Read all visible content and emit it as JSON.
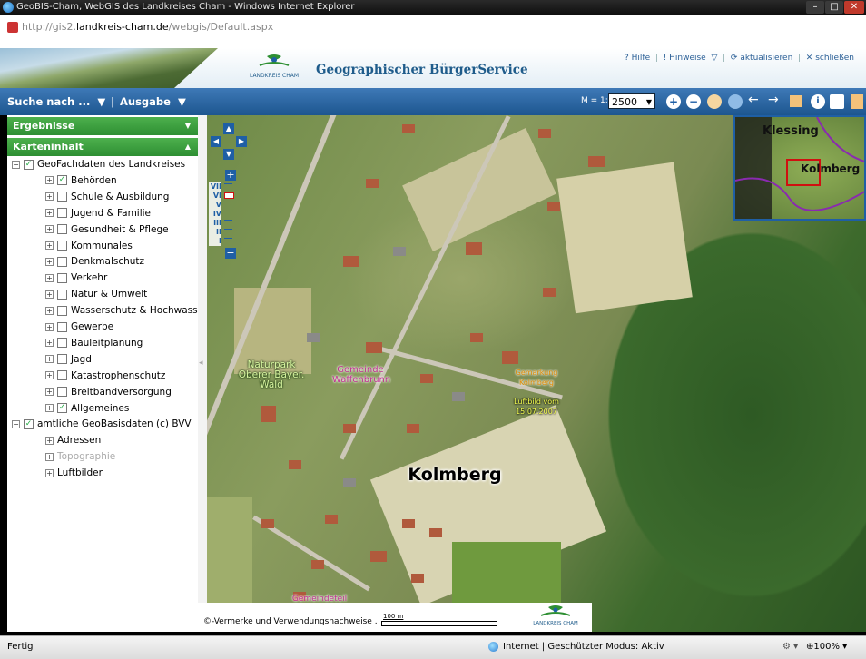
{
  "window": {
    "title": "GeoBIS-Cham, WebGIS des Landkreises Cham - Windows Internet Explorer",
    "url_prefix": "http://gis2.",
    "url_domain": "landkreis-cham.de",
    "url_path": "/webgis/Default.aspx"
  },
  "header": {
    "logo_text": "LANDKREIS CHAM",
    "app_title": "Geographischer BürgerService",
    "link_help": "? Hilfe",
    "link_hints": "! Hinweise",
    "link_refresh": "aktualisieren",
    "link_close": "schließen"
  },
  "toolbar": {
    "search_label": "Suche nach ...",
    "output_label": "Ausgabe",
    "scale_label": "M = 1:",
    "scale_value": "2500"
  },
  "panel": {
    "results_title": "Ergebnisse",
    "content_title": "Karteninhalt",
    "root1": {
      "label": "GeoFachdaten des Landkreises",
      "checked": true
    },
    "layers": [
      {
        "label": "Behörden",
        "checked": true
      },
      {
        "label": "Schule & Ausbildung",
        "checked": false
      },
      {
        "label": "Jugend & Familie",
        "checked": false
      },
      {
        "label": "Gesundheit & Pflege",
        "checked": false
      },
      {
        "label": "Kommunales",
        "checked": false
      },
      {
        "label": "Denkmalschutz",
        "checked": false
      },
      {
        "label": "Verkehr",
        "checked": false
      },
      {
        "label": "Natur & Umwelt",
        "checked": false
      },
      {
        "label": "Wasserschutz & Hochwasser",
        "checked": false
      },
      {
        "label": "Gewerbe",
        "checked": false
      },
      {
        "label": "Bauleitplanung",
        "checked": false
      },
      {
        "label": "Jagd",
        "checked": false
      },
      {
        "label": "Katastrophenschutz",
        "checked": false
      },
      {
        "label": "Breitbandversorgung",
        "checked": false
      },
      {
        "label": "Allgemeines",
        "checked": true
      }
    ],
    "root2": {
      "label": "amtliche GeoBasisdaten (c) BVV",
      "checked": true
    },
    "base_layers": [
      {
        "label": "Adressen",
        "disabled": false
      },
      {
        "label": "Topographie",
        "disabled": true
      },
      {
        "label": "Luftbilder",
        "disabled": false
      }
    ]
  },
  "map": {
    "zoom_levels": [
      "VII",
      "VI",
      "V",
      "IV",
      "III",
      "II",
      "I"
    ],
    "label_naturpark": "Naturpark Oberer Bayer. Wald",
    "label_gemeinde": "Gemeinde Waffenbrunn",
    "label_gemarkung": "Gemarkung Kolmberg",
    "label_luftbild": "Luftbild vom 15.07.2007",
    "label_place": "Kolmberg",
    "label_gemeindeteil": "Gemeindeteil",
    "overview_text": "Kolmberg",
    "overview_text2": "Klessing",
    "footer_text": "©-Vermerke und Verwendungsnachweise .",
    "scalebar_label": "100 m",
    "footer_logo": "LANDKREIS CHAM"
  },
  "status": {
    "left": "Fertig",
    "zone": "Internet | Geschützter Modus: Aktiv",
    "zoom": "100%"
  },
  "colors": {
    "accent_blue": "#1d568f",
    "panel_green": "#2e8f33"
  }
}
